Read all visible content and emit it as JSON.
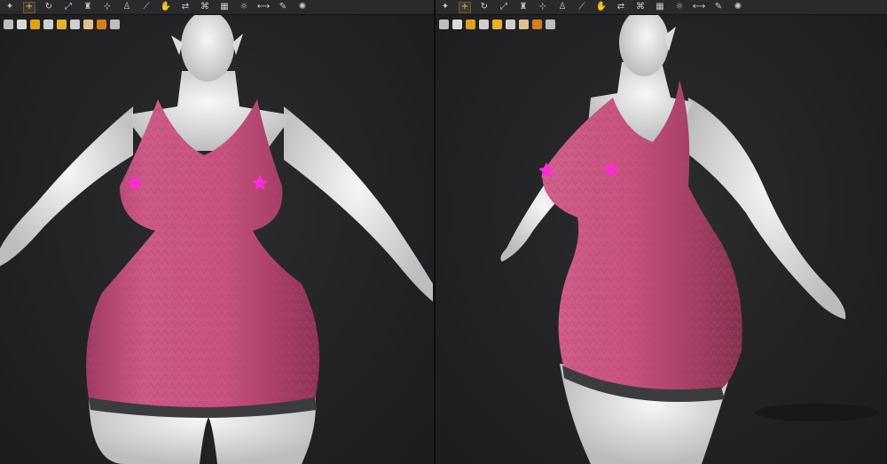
{
  "toolbar": {
    "icons": [
      "pin-icon",
      "move-icon",
      "rotate-icon",
      "scale-icon",
      "shirt-icon",
      "node-icon",
      "pose-icon",
      "joint-icon",
      "grab-icon",
      "transfer-icon",
      "region-icon",
      "geometry-icon",
      "spotlight-icon",
      "measure-icon",
      "edit-icon",
      "magic-icon"
    ],
    "active_index": 1
  },
  "iconbar": {
    "icons": [
      "bone-icon",
      "cloth-icon",
      "puzzle-icon",
      "figure-icon",
      "folder-icon",
      "camera-icon",
      "face-icon",
      "bulb-icon",
      "export-icon"
    ],
    "colors": [
      "#bfbfbf",
      "#d9d9d9",
      "#e0a020",
      "#cfcfcf",
      "#e8b030",
      "#cfcfcf",
      "#e0c090",
      "#d08020",
      "#bdbdbd"
    ]
  },
  "scene": {
    "dress_color": "#c8517f",
    "hem_color": "#3c3b3e",
    "skin_color": "#e9e9e9",
    "marker_color": "#ff2bd6"
  }
}
